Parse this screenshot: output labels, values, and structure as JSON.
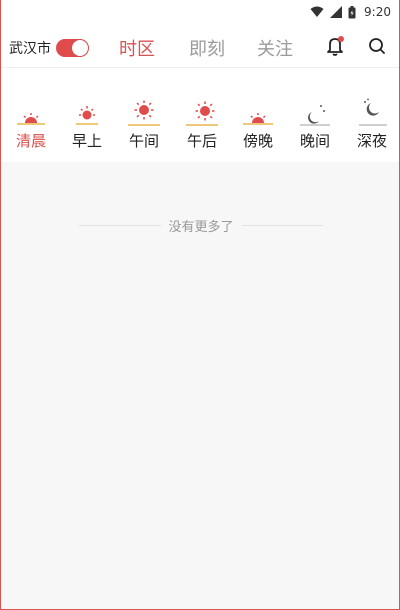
{
  "status_bar": {
    "time": "9:20",
    "icons": [
      "wifi-icon",
      "signal-icon",
      "battery-icon"
    ]
  },
  "header": {
    "city": "武汉市",
    "location_toggle_on": true,
    "tabs": [
      {
        "label": "时区",
        "active": true
      },
      {
        "label": "即刻",
        "active": false
      },
      {
        "label": "关注",
        "active": false
      }
    ],
    "icons": [
      "bell-icon",
      "search-icon"
    ],
    "notification_dot": true
  },
  "periods": [
    {
      "label": "清晨",
      "icon": "sunrise-icon",
      "active": true
    },
    {
      "label": "早上",
      "icon": "morning-sun-icon",
      "active": false
    },
    {
      "label": "午间",
      "icon": "noon-sun-icon",
      "active": false
    },
    {
      "label": "午后",
      "icon": "afternoon-sun-icon",
      "active": false
    },
    {
      "label": "傍晚",
      "icon": "sunset-icon",
      "active": false
    },
    {
      "label": "晚间",
      "icon": "evening-moon-icon",
      "active": false
    },
    {
      "label": "深夜",
      "icon": "night-moon-icon",
      "active": false
    }
  ],
  "feed": {
    "empty_text": "没有更多了"
  },
  "colors": {
    "accent": "#d9534f",
    "inactive_tab": "#9a9a9a",
    "sun": "#e04b4b",
    "horizon": "#f0c87a",
    "moon": "#555555"
  }
}
